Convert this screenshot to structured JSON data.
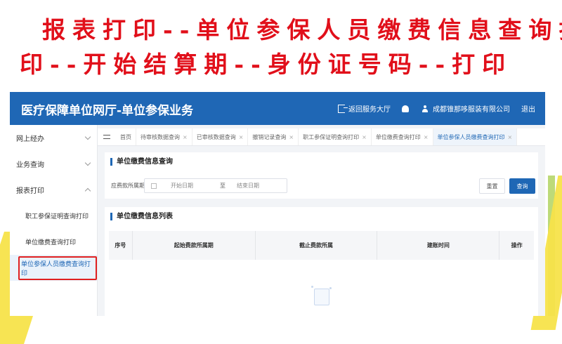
{
  "banner": {
    "line1": "报表打印--单位参保人员缴费信息查询打",
    "line2": "印--开始结算期--身份证号码--打印"
  },
  "app": {
    "title": "医疗保障单位网厅-单位参保业务",
    "return_label": "返回服务大厅",
    "company": "成都锥那哆服装有限公司",
    "logout": "退出"
  },
  "sidebar": {
    "groups": [
      {
        "label": "网上经办"
      },
      {
        "label": "业务查询"
      },
      {
        "label": "报表打印"
      }
    ],
    "items": [
      {
        "label": "职工参保证明查询打印"
      },
      {
        "label": "单位缴费查询打印"
      },
      {
        "label": "单位参保人员缴费查询打印"
      }
    ]
  },
  "tabs": [
    {
      "label": "首页"
    },
    {
      "label": "待审核数据查询"
    },
    {
      "label": "已审核数据查询"
    },
    {
      "label": "撤销记录查询"
    },
    {
      "label": "职工参保证明查询打印"
    },
    {
      "label": "单位缴费查询打印"
    },
    {
      "label": "单位参保人员缴费查询打印"
    }
  ],
  "tab_close": "×",
  "query": {
    "title": "单位缴费信息查询",
    "label": "应费款所属期",
    "start_placeholder": "开始日期",
    "separator": "至",
    "end_placeholder": "结束日期",
    "reset": "重置",
    "search": "查询"
  },
  "list": {
    "title": "单位缴费信息列表",
    "columns": [
      "序号",
      "起始费款所属期",
      "截止费款所属",
      "建账时间",
      "操作"
    ]
  },
  "colors": {
    "brand": "#1f67b5",
    "banner_red": "#e10f1a",
    "highlight": "#e02020"
  }
}
